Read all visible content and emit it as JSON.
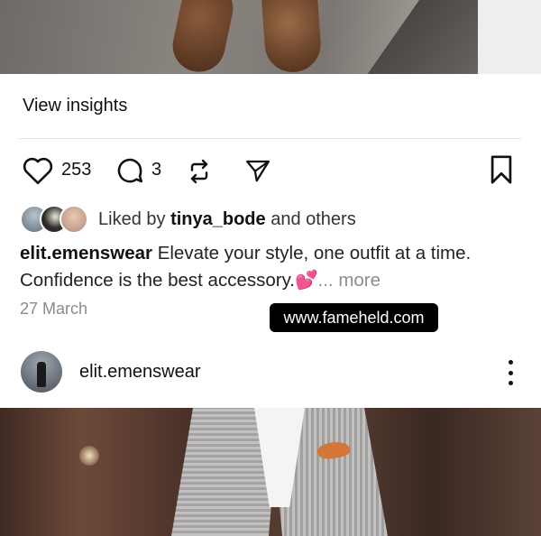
{
  "post_top": {
    "image_alt": "brown leather shoes on stairs"
  },
  "insights": {
    "label": "View insights"
  },
  "actions": {
    "like_count": "253",
    "comment_count": "3",
    "like_icon": "heart-icon",
    "comment_icon": "comment-icon",
    "repost_icon": "repost-icon",
    "share_icon": "send-icon",
    "save_icon": "bookmark-icon"
  },
  "likes": {
    "prefix": "Liked by ",
    "user": "tinya_bode",
    "suffix": " and others"
  },
  "caption": {
    "username": "elit.emenswear",
    "text": " Elevate your style, one outfit at a time. Confidence is the best accessory.",
    "emoji": "💕",
    "more": "... more"
  },
  "date": "27 March",
  "watermark": "www.fameheld.com",
  "next_post": {
    "username": "elit.emenswear",
    "image_alt": "man in grey checked blazer"
  },
  "colors": {
    "text": "#111111",
    "muted": "#8e8e8e",
    "heart_emoji": "#e6398c",
    "watermark_bg": "#000000"
  }
}
